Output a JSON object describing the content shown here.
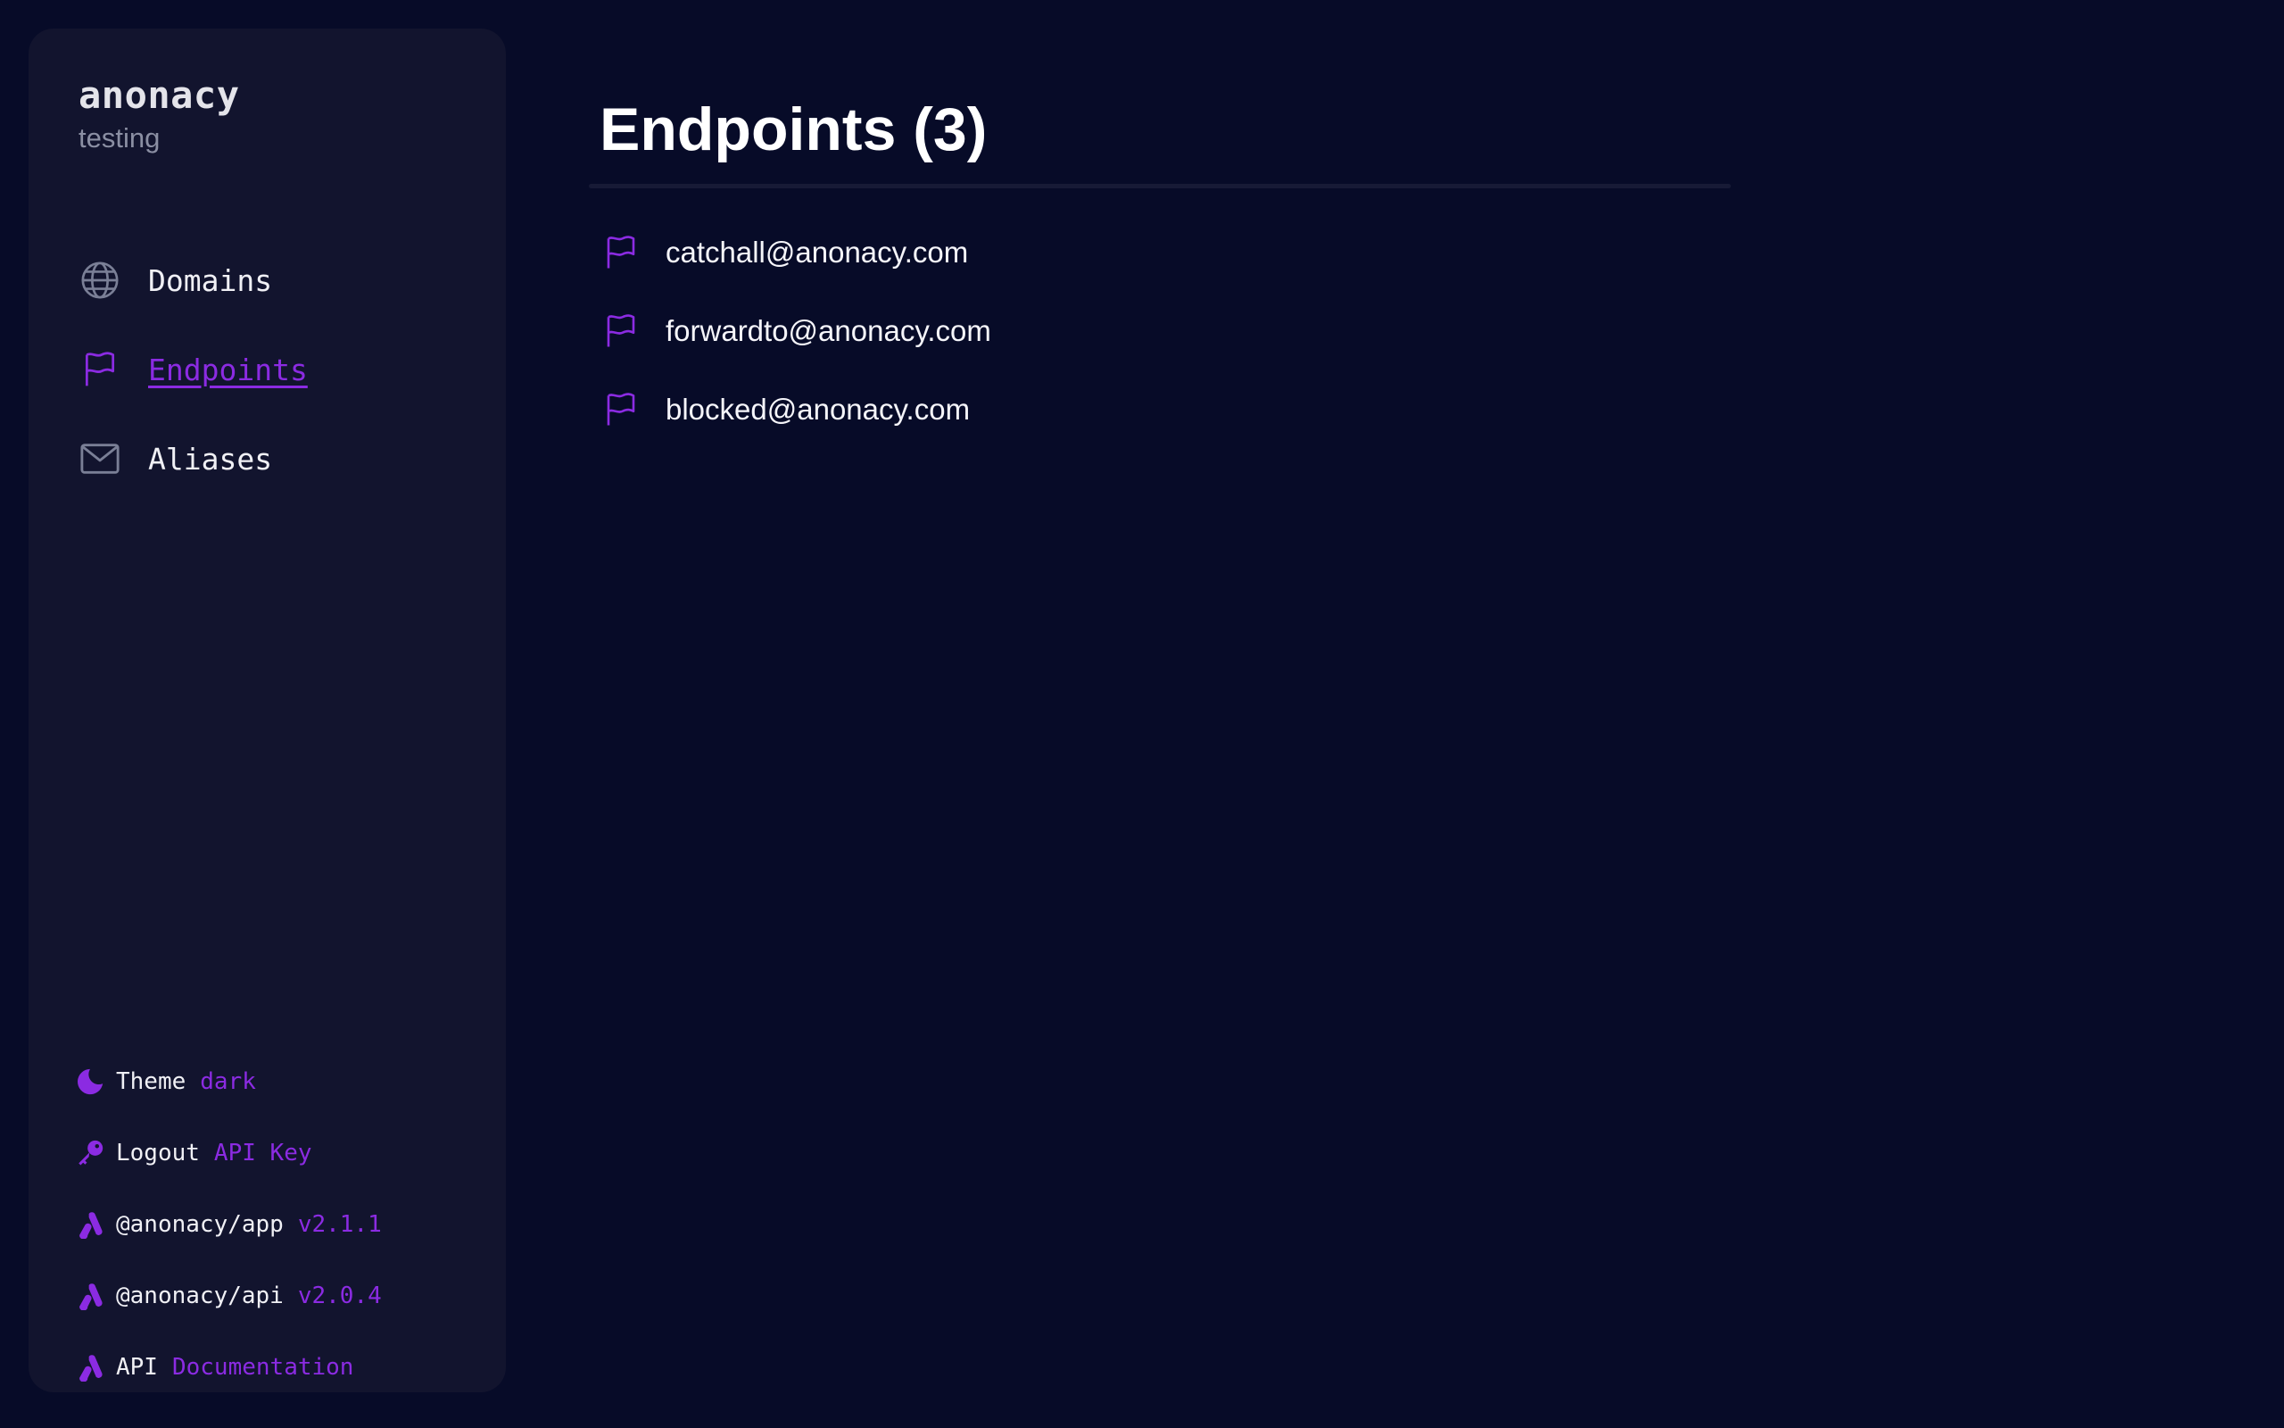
{
  "brand": {
    "name": "anonacy",
    "subtitle": "testing"
  },
  "nav": {
    "items": [
      {
        "label": "Domains",
        "icon": "globe-icon",
        "active": false
      },
      {
        "label": "Endpoints",
        "icon": "flag-icon",
        "active": true
      },
      {
        "label": "Aliases",
        "icon": "envelope-icon",
        "active": false
      }
    ]
  },
  "footer": {
    "theme": {
      "key": "Theme",
      "value": "dark",
      "icon": "moon-icon"
    },
    "logout": {
      "key": "Logout",
      "value": "API Key",
      "icon": "key-icon"
    },
    "app": {
      "key": "@anonacy/app",
      "value": "v2.1.1",
      "icon": "anonacy-logo-icon"
    },
    "api": {
      "key": "@anonacy/api",
      "value": "v2.0.4",
      "icon": "anonacy-logo-icon"
    },
    "docs": {
      "key": "API",
      "value": "Documentation",
      "icon": "anonacy-logo-icon"
    }
  },
  "main": {
    "title": "Endpoints (3)",
    "endpoints": [
      {
        "email": "catchall@anonacy.com",
        "icon": "flag-icon"
      },
      {
        "email": "forwardto@anonacy.com",
        "icon": "flag-icon"
      },
      {
        "email": "blocked@anonacy.com",
        "icon": "flag-icon"
      }
    ]
  },
  "colors": {
    "background": "#070b28",
    "sidebar": "#12142e",
    "accent": "#8b2be2",
    "text": "#ffffff",
    "muted": "#8b8fa3"
  }
}
